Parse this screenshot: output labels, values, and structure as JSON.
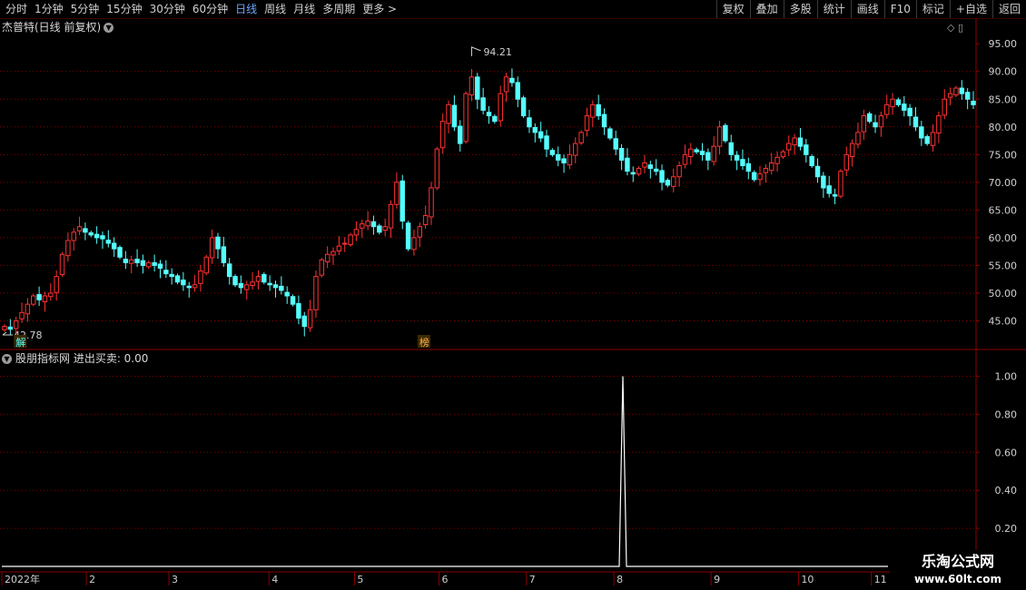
{
  "toolbar": {
    "periods": [
      "分时",
      "1分钟",
      "5分钟",
      "15分钟",
      "30分钟",
      "60分钟",
      "日线",
      "周线",
      "月线",
      "多周期",
      "更多 >"
    ],
    "active_period": "日线",
    "actions": [
      "复权",
      "叠加",
      "多股",
      "统计",
      "画线",
      "F10",
      "标记",
      "+自选",
      "返回"
    ]
  },
  "main_title": "杰普特(日线 前复权)",
  "sub_title": "股朋指标网  进出买卖: 0.00",
  "corner_icons": "◇ ▯",
  "colors": {
    "up": "#ff3232",
    "down": "#54ffff",
    "grid": "#8c0000",
    "signal": "#ffffff"
  },
  "chart_data": [
    {
      "type": "candlestick",
      "title": "杰普特(日线 前复权)",
      "y_ticks": [
        "95.00",
        "90.00",
        "85.00",
        "80.00",
        "75.00",
        "70.00",
        "65.00",
        "60.00",
        "55.00",
        "50.00",
        "45.00"
      ],
      "ylim": [
        40,
        97
      ],
      "high_label": "94.21",
      "low_label": "42.78",
      "markers": [
        "解",
        "榜"
      ],
      "closes": [
        44,
        43.5,
        45,
        46.5,
        48,
        49.5,
        48.8,
        49.5,
        50,
        53,
        57,
        59.5,
        61,
        62,
        61,
        60.5,
        60,
        59.8,
        59,
        58,
        56.5,
        55.5,
        56,
        55.5,
        55,
        55.5,
        55,
        54.5,
        53.5,
        53,
        52,
        51.5,
        51,
        51.5,
        54,
        56.5,
        60,
        58,
        55.5,
        53,
        51.5,
        51,
        51.5,
        52,
        53,
        52,
        51.5,
        51,
        50.5,
        49.5,
        48,
        45.5,
        44,
        47,
        53,
        56,
        57,
        57.5,
        58.5,
        59,
        60.5,
        61.5,
        62.5,
        63,
        62,
        61,
        62,
        66,
        70,
        63,
        58,
        60,
        62,
        64,
        69,
        76,
        81,
        84,
        80,
        77,
        86,
        89,
        85,
        83,
        82,
        81,
        86,
        89,
        88,
        85,
        82,
        80,
        79,
        78,
        76,
        75,
        74,
        73.5,
        75,
        77,
        79,
        82,
        84,
        82,
        80,
        78,
        76,
        74,
        72,
        71.5,
        72.5,
        73.5,
        72.5,
        72,
        70,
        69.5,
        71,
        73,
        75,
        76,
        75.5,
        75,
        74,
        76.5,
        80,
        77.5,
        75,
        74,
        73,
        72,
        70.5,
        71.5,
        72.5,
        73.5,
        74.5,
        75.5,
        77,
        78,
        76.5,
        75,
        73,
        71,
        69,
        68,
        67.5,
        72,
        75,
        77,
        79,
        82,
        81,
        80,
        82,
        84,
        85,
        84,
        83,
        82,
        80,
        78,
        77,
        79,
        82,
        85,
        86,
        87,
        86,
        85,
        84
      ],
      "x_ticks": [
        "2022年",
        "2",
        "3",
        "4",
        "5",
        "6",
        "7",
        "8",
        "9",
        "10",
        "11"
      ]
    },
    {
      "type": "line",
      "title": "股朋指标网  进出买卖: 0.00",
      "y_ticks": [
        "1.00",
        "0.80",
        "0.60",
        "0.40",
        "0.20"
      ],
      "ylim": [
        0,
        1.05
      ],
      "values": [
        0,
        0,
        1,
        0,
        0
      ]
    }
  ],
  "watermark": {
    "title": "乐淘公式网",
    "url": "www.60lt.com"
  }
}
